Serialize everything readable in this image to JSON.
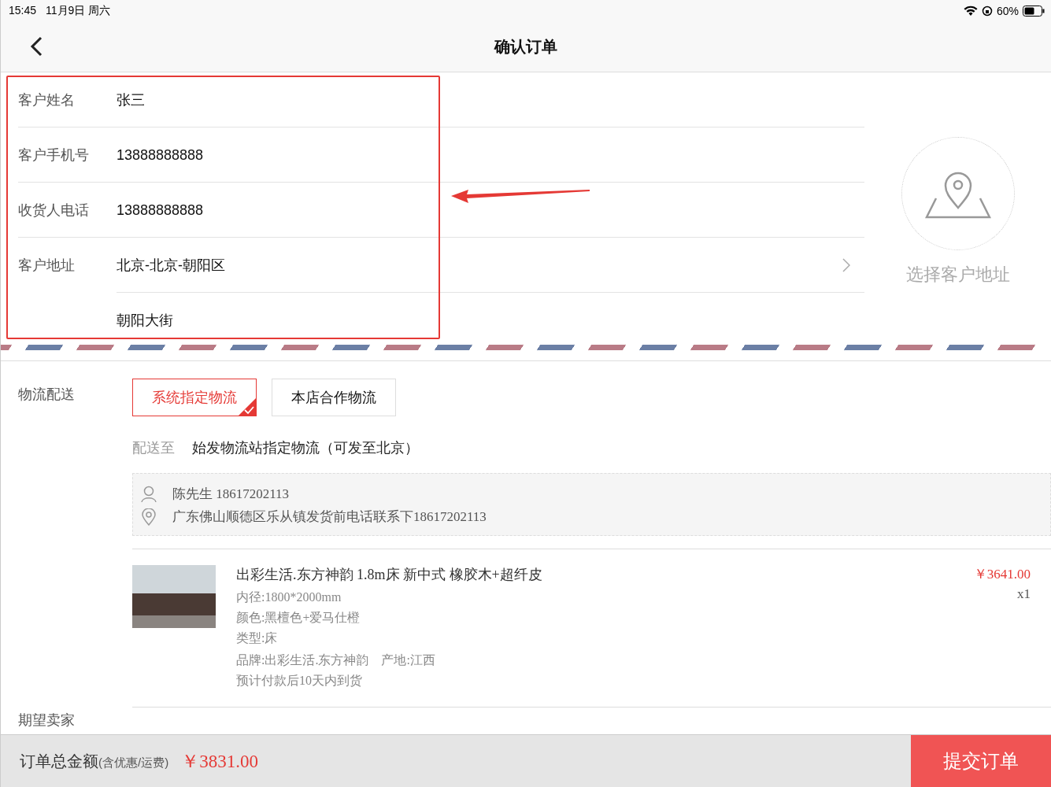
{
  "status_bar": {
    "time": "15:45",
    "date": "11月9日 周六",
    "battery": "60%"
  },
  "nav": {
    "title": "确认订单"
  },
  "customer": {
    "fields": [
      {
        "kind": "text",
        "label": "客户姓名",
        "value": "张三"
      },
      {
        "kind": "text",
        "label": "客户手机号",
        "value": "13888888888"
      },
      {
        "kind": "text",
        "label": "收货人电话",
        "value": "13888888888"
      },
      {
        "kind": "picker",
        "label": "客户地址",
        "value": "北京-北京-朝阳区"
      },
      {
        "kind": "text",
        "value": "朝阳大街"
      }
    ],
    "address_picker": {
      "label": "选择客户地址"
    }
  },
  "logistics": {
    "label": "物流配送",
    "options": [
      {
        "label": "系统指定物流",
        "selected": true
      },
      {
        "label": "本店合作物流",
        "selected": false
      }
    ],
    "ship_to_label": "配送至",
    "ship_to": "始发物流站指定物流（可发至北京）",
    "sender": {
      "contact": "陈先生 18617202113",
      "address": "广东佛山顺德区乐从镇发货前电话联系下18617202113"
    }
  },
  "product": {
    "title": "出彩生活.东方神韵 1.8m床 新中式 橡胶木+超纤皮",
    "attributes": [
      "内径:1800*2000mm",
      "颜色:黑檀色+爱马仕橙",
      "类型:床",
      "品牌:出彩生活.东方神韵　产地:江西",
      "预计付款后10天内到货"
    ],
    "price": "￥3641.00",
    "quantity": "x1"
  },
  "next_section": {
    "label": "期望卖家"
  },
  "footer": {
    "total_label": "订单总金额",
    "total_note": "(含优惠/运费)",
    "total": "￥3831.00",
    "submit": "提交订单"
  }
}
